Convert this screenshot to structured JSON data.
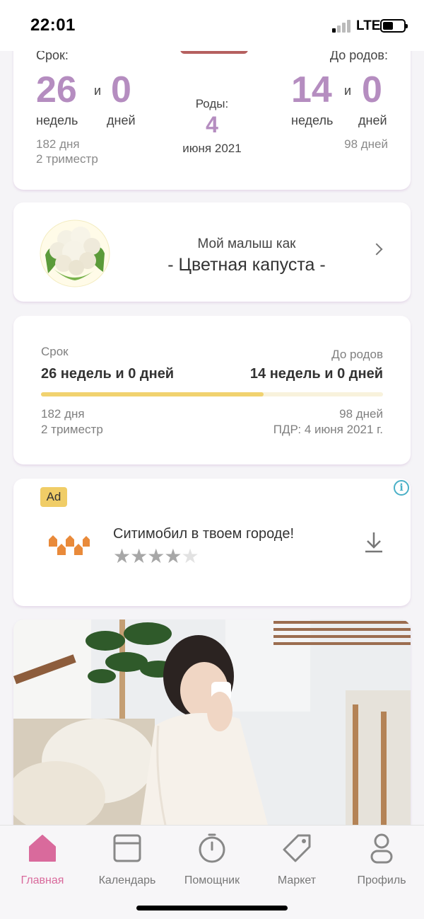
{
  "status_bar": {
    "time": "22:01",
    "network": "LTE"
  },
  "term_card": {
    "left_label": "Срок:",
    "left_weeks": "26",
    "conj": "и",
    "left_days": "0",
    "weeks_unit": "недель",
    "days_unit": "дней",
    "left_total_days": "182 дня",
    "left_trimester": "2 триместр",
    "birth_label": "Роды:",
    "birth_day": "4",
    "birth_month": "июня 2021",
    "right_label": "До родов:",
    "right_weeks": "14",
    "right_days": "0",
    "right_total_days": "98 дней"
  },
  "baby_card": {
    "title": "Мой малыш как",
    "name": "- Цветная капуста -",
    "icon": "cauliflower"
  },
  "progress_card": {
    "left_label": "Срок",
    "left_value": "26 недель и 0 дней",
    "right_label": "До родов",
    "right_value": "14 недель и 0 дней",
    "progress_fraction": 0.65,
    "left_days": "182 дня",
    "left_trimester": "2 триместр",
    "right_days": "98 дней",
    "due_date": "ПДР: 4 июня 2021 г."
  },
  "ad_card": {
    "badge": "Ad",
    "title": "Ситимобил в твоем городе!",
    "rating": 4,
    "rating_max": 5,
    "icons": [
      "info-icon",
      "download-icon",
      "citymobil-logo"
    ]
  },
  "tabs": [
    {
      "label": "Главная",
      "icon": "home-icon",
      "active": true
    },
    {
      "label": "Календарь",
      "icon": "calendar-icon",
      "active": false
    },
    {
      "label": "Помощник",
      "icon": "timer-icon",
      "active": false
    },
    {
      "label": "Маркет",
      "icon": "tag-icon",
      "active": false
    },
    {
      "label": "Профиль",
      "icon": "profile-icon",
      "active": false
    }
  ],
  "colors": {
    "accent_purple": "#b58dc0",
    "accent_pink": "#d96a9c",
    "progress_yellow": "#f1d26f",
    "ad_badge": "#f0cd67",
    "info_blue": "#4ab0c7",
    "logo_orange": "#e98a3a"
  }
}
